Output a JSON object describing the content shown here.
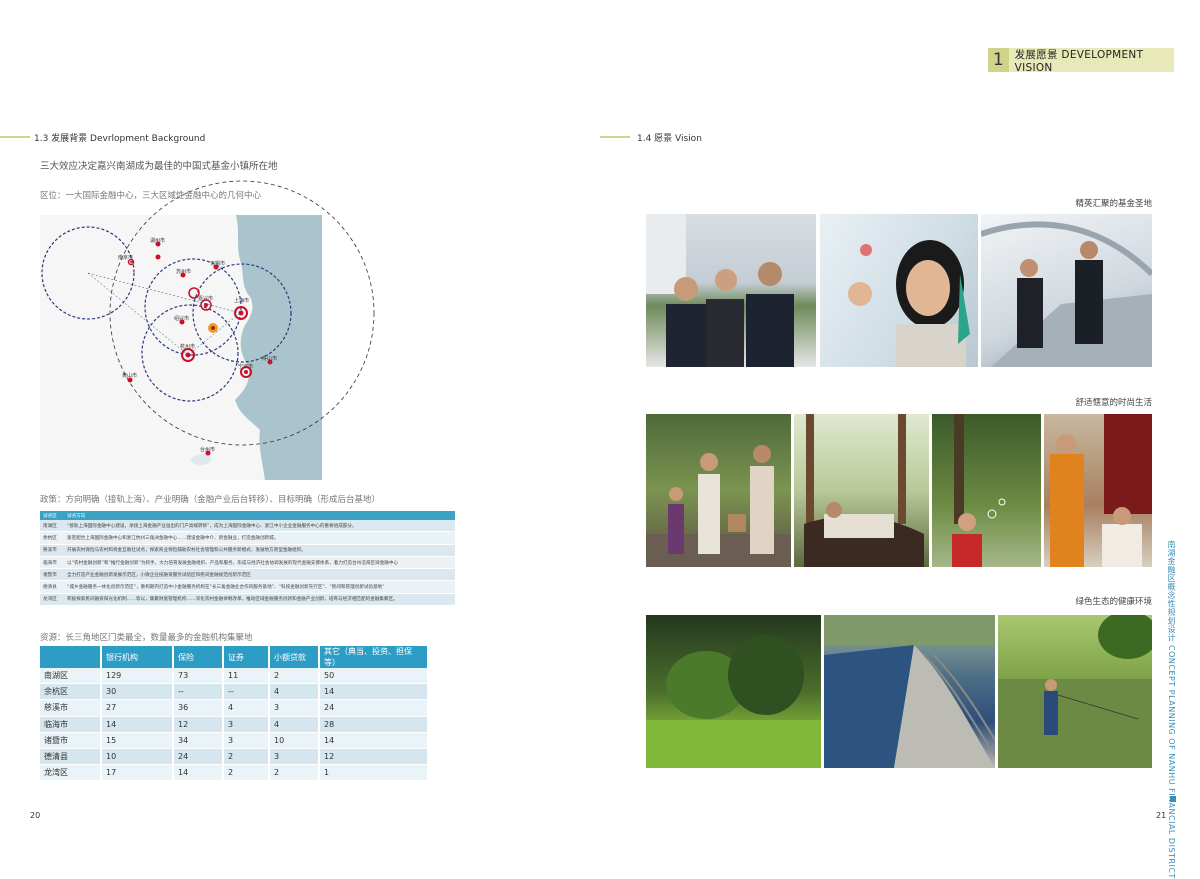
{
  "header": {
    "chapter_num": "1",
    "chapter_title": "发展愿景 DEVELOPMENT  VISION"
  },
  "left": {
    "section_title": "1.3 发展背景  Devrlopment Background",
    "subtitle": "三大效应决定嘉兴南湖成为最佳的中国式基金小镇所在地",
    "location_note": "区位：一大国际金融中心，三大区域性金融中心的几何中心",
    "map": {
      "cities": [
        "湖州市",
        "南京市",
        "苏州市",
        "无锡市",
        "嘉兴市",
        "上海市",
        "杭州市",
        "绍兴市",
        "宁波市",
        "黄山市",
        "舟山市",
        "台州市"
      ]
    },
    "policy_note": "政策：方向明确（接轨上海）、产业明确（金融产业后台转移）、目标明确（形成后台基地）",
    "policy_table": {
      "headers": [
        "试点区",
        "试点方向"
      ],
      "rows": [
        [
          "南湖区",
          "“接轨上海国际金融中心建设，承接上海金融产业溢出的门户高端转移”，成为上海国际金融中心、浙江中小企业金融服务中心的重要组成部分。"
        ],
        [
          "余杭区",
          "紧密配合上海国际金融中心和浙江杭州三角洲金融中心……建设金融中介、新金融业，打造金融创新城。"
        ],
        [
          "慈溪市",
          "开展农村保险与农村和资金互助社试点，探索商业保险辅助农村社会管理和公共服务新模式，发展地方新型金融组织。"
        ],
        [
          "临海市",
          "以“农村金融创新”和“推行金融创新”为抓手，大力培育发展金融组织、产品和服务，形成与经济社会协调发展的现代金融支撑体系，着力打造台州沿海区域金融中心"
        ],
        [
          "诸暨市",
          "全力打造产业金融创新发展示范区，小微企业投融资服务试验区和民间金融规范创新示范区"
        ],
        [
          "德清县",
          "“城乡金融服务一体化创新示范区”，重构期内打造中小金融服务机构在“长三角金融业合作的服务基地”、“科技金融创新先行区”、“民间和管理创新试验基地”"
        ],
        [
          "龙湾区",
          "积极探索民间融资阳光化机制……等以，集聚财富管理机构……深化农村金融体制改革，推动区域金融服务创新和金融产业创新，培育与经济相匹配的金融集聚区。"
        ]
      ]
    },
    "resource_note": "资源：长三角地区门类最全，数量最多的金融机构集聚地",
    "resource_table": {
      "headers": [
        "",
        "银行机构",
        "保险",
        "证券",
        "小额贷款",
        "其它（典当、投资、担保等）"
      ],
      "rows": [
        [
          "南湖区",
          "129",
          "73",
          "11",
          "2",
          "50"
        ],
        [
          "余杭区",
          "30",
          "--",
          "--",
          "4",
          "14"
        ],
        [
          "慈溪市",
          "27",
          "36",
          "4",
          "3",
          "24"
        ],
        [
          "临海市",
          "14",
          "12",
          "3",
          "4",
          "28"
        ],
        [
          "诸暨市",
          "15",
          "34",
          "3",
          "10",
          "14"
        ],
        [
          "德清县",
          "10",
          "24",
          "2",
          "3",
          "12"
        ],
        [
          "龙湾区",
          "17",
          "14",
          "2",
          "2",
          "1"
        ]
      ]
    },
    "page_number": "20"
  },
  "right": {
    "section_title": "1.4 愿景  Vision",
    "captions": [
      "精英汇聚的基金圣地",
      "舒适惬意的时尚生活",
      "绿色生态的健康环境"
    ],
    "vertical_text": "南湖金融区概念性规划设计  CONCEPT PLANNING OF NANHU FINANCIAL DISTRICT",
    "page_number": "21"
  },
  "colors": {
    "accent": "#d0d38a",
    "table_blue": "#2e9dc6"
  }
}
